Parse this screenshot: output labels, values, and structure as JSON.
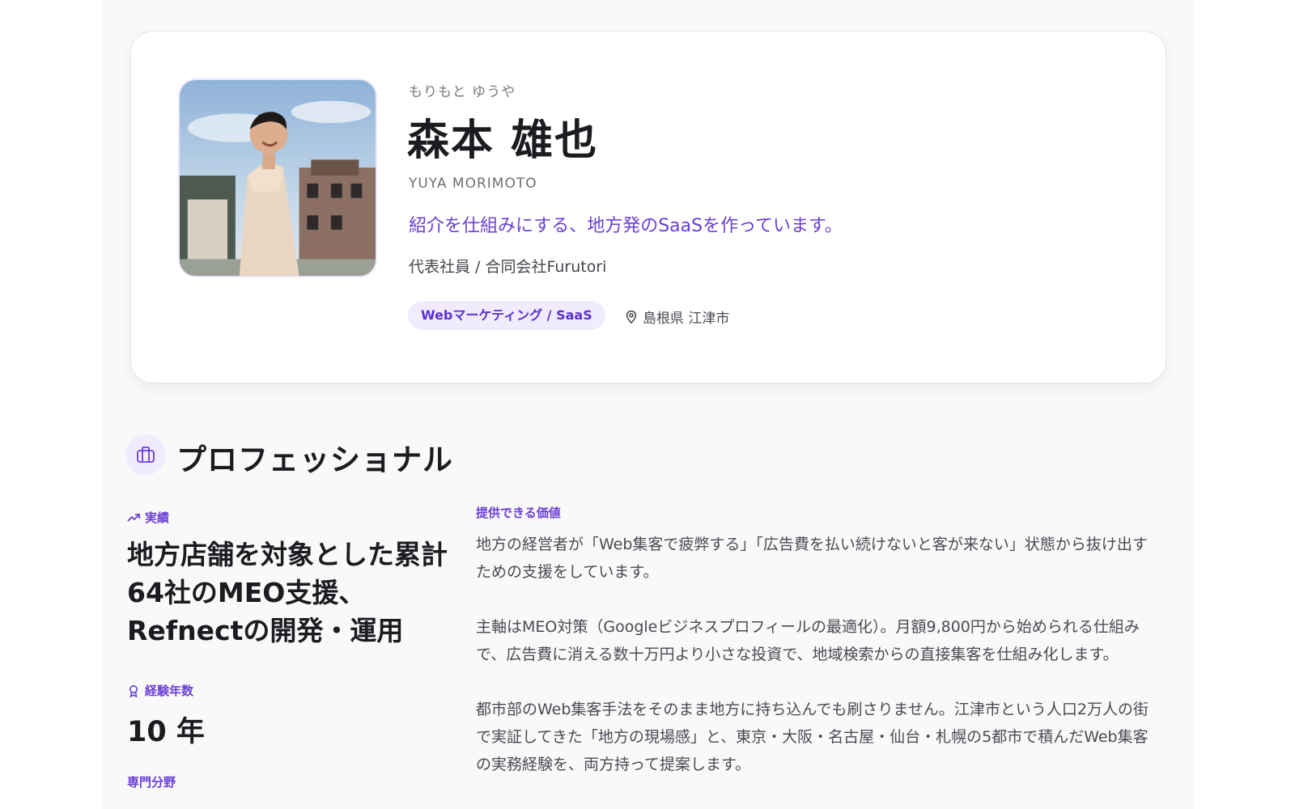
{
  "profile": {
    "kana": "もりもと ゆうや",
    "name": "森本 雄也",
    "roman": "YUYA MORIMOTO",
    "tagline": "紹介を仕組みにする、地方発のSaaSを作っています。",
    "role": "代表社員 / 合同会社Furutori",
    "tag": "Webマーケティング / SaaS",
    "location": "島根県 江津市",
    "accent_color": "#6b3fd6"
  },
  "section": {
    "title": "プロフェッショナル",
    "icon": "briefcase-icon"
  },
  "achievements": {
    "label": "実績",
    "icon": "trending-up-icon",
    "text": "地方店舗を対象とした累計64社のMEO支援、Refnectの開発・運用"
  },
  "experience": {
    "label": "経験年数",
    "icon": "award-icon",
    "value": "10 年"
  },
  "field": {
    "label": "専門分野"
  },
  "value": {
    "label": "提供できる価値",
    "paragraphs": [
      "地方の経営者が「Web集客で疲弊する」「広告費を払い続けないと客が来ない」状態から抜け出すための支援をしています。",
      "主軸はMEO対策（Googleビジネスプロフィールの最適化）。月額9,800円から始められる仕組みで、広告費に消える数十万円より小さな投資で、地域検索からの直接集客を仕組み化します。",
      "都市部のWeb集客手法をそのまま地方に持ち込んでも刷さりません。江津市という人口2万人の街で実証してきた「地方の現場感」と、東京・大阪・名古屋・仙台・札幌の5都市で積んだWeb集客の実務経験を、両方持って提案します。"
    ]
  }
}
